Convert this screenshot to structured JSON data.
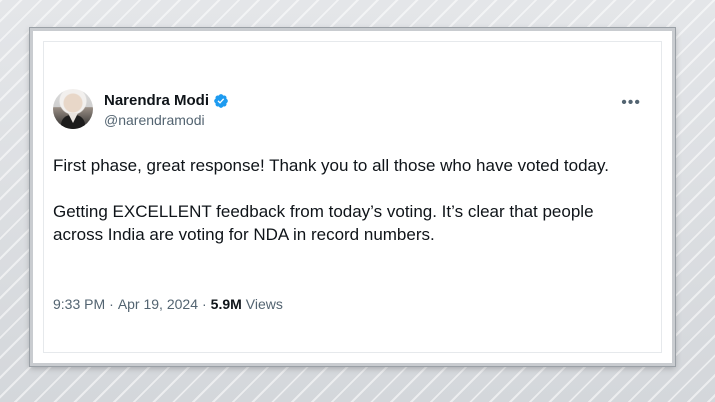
{
  "tweet": {
    "display_name": "Narendra Modi",
    "handle": "@narendramodi",
    "paragraphs": [
      "First phase, great response! Thank you to all those who have voted today.",
      "Getting EXCELLENT feedback from today’s voting. It’s clear that people across India are voting for NDA in record numbers."
    ],
    "time": "9:33 PM",
    "separator": "·",
    "date": "Apr 19, 2024",
    "views_count": "5.9M",
    "views_label": "Views",
    "more_menu": "•••"
  },
  "colors": {
    "verified_badge": "#1d9bf0",
    "text_primary": "#0f1419",
    "text_secondary": "#536471"
  },
  "icons": {
    "verified": "verified-badge-icon",
    "more": "more-options-icon"
  }
}
